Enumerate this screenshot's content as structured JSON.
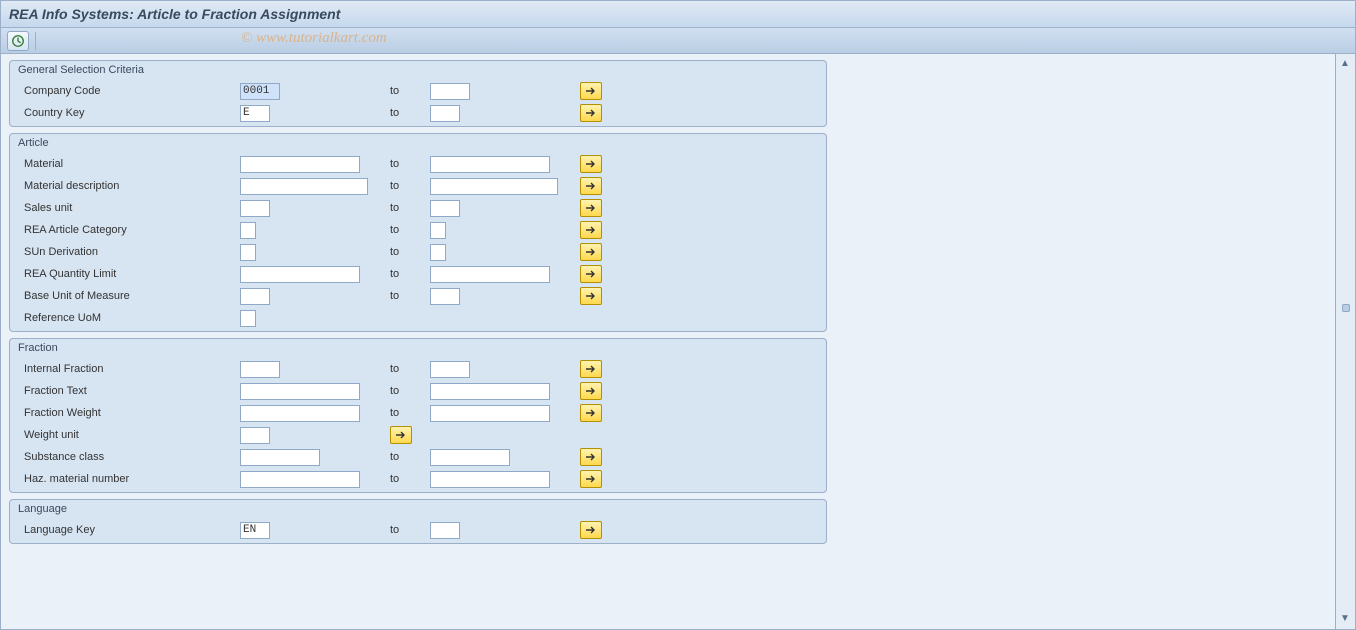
{
  "title": "REA Info Systems: Article to Fraction Assignment",
  "watermark": "© www.tutorialkart.com",
  "labels": {
    "to": "to"
  },
  "groups": {
    "general": {
      "title": "General Selection Criteria",
      "fields": {
        "company_code": {
          "label": "Company Code",
          "from": "0001",
          "to": ""
        },
        "country_key": {
          "label": "Country Key",
          "from": "E",
          "to": ""
        }
      }
    },
    "article": {
      "title": "Article",
      "fields": {
        "material": {
          "label": "Material",
          "from": "",
          "to": ""
        },
        "material_desc": {
          "label": "Material description",
          "from": "",
          "to": ""
        },
        "sales_unit": {
          "label": "Sales unit",
          "from": "",
          "to": ""
        },
        "rea_cat": {
          "label": "REA Article Category",
          "from": "",
          "to": ""
        },
        "sun_deriv": {
          "label": "SUn Derivation",
          "from": "",
          "to": ""
        },
        "rea_qty": {
          "label": "REA Quantity Limit",
          "from": "",
          "to": ""
        },
        "base_uom": {
          "label": "Base Unit of Measure",
          "from": "",
          "to": ""
        },
        "ref_uom": {
          "label": "Reference UoM",
          "from": ""
        }
      }
    },
    "fraction": {
      "title": "Fraction",
      "fields": {
        "internal_frac": {
          "label": "Internal Fraction",
          "from": "",
          "to": ""
        },
        "frac_text": {
          "label": "Fraction Text",
          "from": "",
          "to": ""
        },
        "frac_weight": {
          "label": "Fraction Weight",
          "from": "",
          "to": ""
        },
        "weight_unit": {
          "label": "Weight unit",
          "from": ""
        },
        "subst_class": {
          "label": "Substance class",
          "from": "",
          "to": ""
        },
        "haz_mat": {
          "label": "Haz. material number",
          "from": "",
          "to": ""
        }
      }
    },
    "language": {
      "title": "Language",
      "fields": {
        "lang_key": {
          "label": "Language Key",
          "from": "EN",
          "to": ""
        }
      }
    }
  }
}
